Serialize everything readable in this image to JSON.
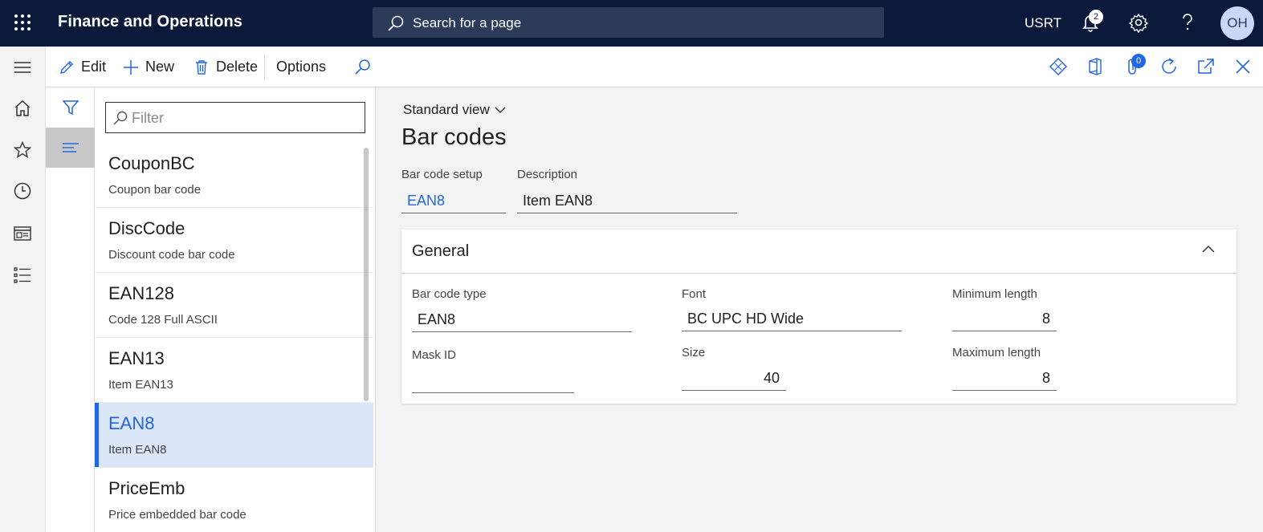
{
  "header": {
    "app_title": "Finance and Operations",
    "search_placeholder": "Search for a page",
    "company": "USRT",
    "notification_count": "2",
    "avatar_initials": "OH",
    "icons": [
      "waffle-icon",
      "search-icon",
      "bell-icon",
      "gear-icon",
      "help-icon"
    ]
  },
  "nav": {
    "icons": [
      "hamburger-icon",
      "home-icon",
      "star-icon",
      "clock-icon",
      "workspace-icon",
      "list-icon"
    ]
  },
  "action_pane": {
    "edit_label": "Edit",
    "new_label": "New",
    "delete_label": "Delete",
    "options_label": "Options",
    "attachments_count": "0",
    "right_icons": [
      "diamond-icon",
      "office-icon",
      "attach-icon",
      "refresh-icon",
      "open-new-icon",
      "close-icon"
    ]
  },
  "list": {
    "filter_placeholder": "Filter",
    "items": [
      {
        "title": "CouponBC",
        "subtitle": "Coupon bar code",
        "selected": false
      },
      {
        "title": "DiscCode",
        "subtitle": "Discount code bar code",
        "selected": false
      },
      {
        "title": "EAN128",
        "subtitle": "Code 128 Full ASCII",
        "selected": false
      },
      {
        "title": "EAN13",
        "subtitle": "Item EAN13",
        "selected": false
      },
      {
        "title": "EAN8",
        "subtitle": "Item EAN8",
        "selected": true
      },
      {
        "title": "PriceEmb",
        "subtitle": "Price embedded bar code",
        "selected": false
      }
    ]
  },
  "details": {
    "view_label": "Standard view",
    "page_title": "Bar codes",
    "bar_code_setup_label": "Bar code setup",
    "bar_code_setup_value": "EAN8",
    "description_label": "Description",
    "description_value": "Item EAN8",
    "general": {
      "title": "General",
      "bar_code_type_label": "Bar code type",
      "bar_code_type_value": "EAN8",
      "mask_id_label": "Mask ID",
      "mask_id_value": "",
      "font_label": "Font",
      "font_value": "BC UPC HD Wide",
      "size_label": "Size",
      "size_value": "40",
      "min_length_label": "Minimum length",
      "min_length_value": "8",
      "max_length_label": "Maximum length",
      "max_length_value": "8"
    }
  },
  "colors": {
    "topbar": "#0b1a3a",
    "accent": "#2266e3",
    "selected_row": "#dce6f9"
  }
}
